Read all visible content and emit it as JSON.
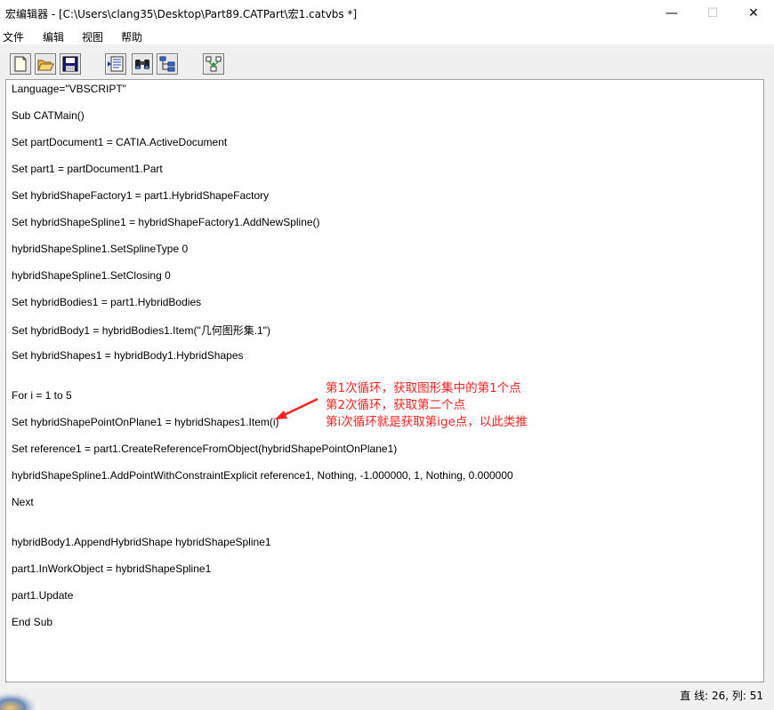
{
  "window": {
    "title": "宏编辑器 - [C:\\Users\\clang35\\Desktop\\Part89.CATPart\\宏1.catvbs *]",
    "minimize": "—",
    "maximize": "☐",
    "close": "✕"
  },
  "menu": [
    "文件",
    "编辑",
    "视图",
    "帮助"
  ],
  "toolbar": [
    "new-file-icon",
    "open-folder-icon",
    "save-disk-icon",
    "object-browser-icon",
    "binoculars-find-icon",
    "tree-structure-icon",
    "tree-network-icon"
  ],
  "code": [
    "Language=\"VBSCRIPT\"",
    "Sub CATMain()",
    "Set partDocument1 = CATIA.ActiveDocument",
    "Set part1 = partDocument1.Part",
    "Set hybridShapeFactory1 = part1.HybridShapeFactory",
    "Set hybridShapeSpline1 = hybridShapeFactory1.AddNewSpline()",
    "hybridShapeSpline1.SetSplineType 0",
    "hybridShapeSpline1.SetClosing 0",
    "Set hybridBodies1 = part1.HybridBodies",
    "Set hybridBody1 = hybridBodies1.Item(\"几何图形集.1\")",
    "Set hybridShapes1 = hybridBody1.HybridShapes",
    "For i = 1 to 5",
    "Set hybridShapePointOnPlane1 = hybridShapes1.Item(i)",
    "Set reference1 = part1.CreateReferenceFromObject(hybridShapePointOnPlane1)",
    "hybridShapeSpline1.AddPointWithConstraintExplicit reference1, Nothing, -1.000000, 1, Nothing, 0.000000",
    "Next",
    "hybridBody1.AppendHybridShape hybridShapeSpline1",
    "part1.InWorkObject = hybridShapeSpline1",
    "part1.Update",
    "End Sub"
  ],
  "annotation": [
    "第1次循环，获取图形集中的第1个点",
    "第2次循环，获取第二个点",
    "第i次循环就是获取第ige点，以此类推"
  ],
  "status": "直 线: 26, 列: 51",
  "colors": {
    "annotation": "#ff2020",
    "background": "#f0f0f0"
  }
}
